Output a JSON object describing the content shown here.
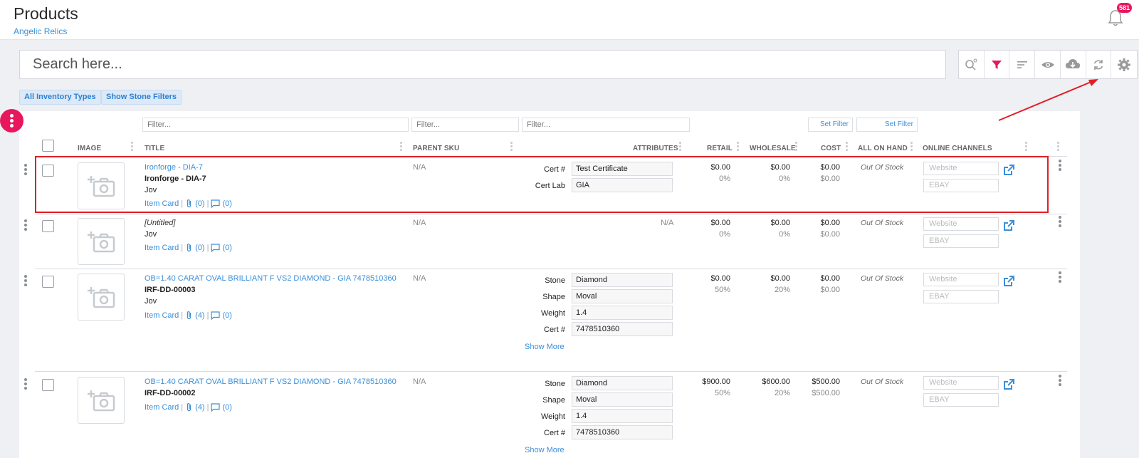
{
  "header": {
    "title": "Products",
    "subtitle": "Angelic Relics",
    "notification_count": "581"
  },
  "search": {
    "placeholder": "Search here..."
  },
  "toolbar": {
    "icons": [
      "search-settings-icon",
      "filter-icon",
      "sort-icon",
      "eye-icon",
      "cloud-download-icon",
      "sync-icon",
      "gear-icon"
    ],
    "filter_color": "#e8175d"
  },
  "filters": {
    "all_inventory": "All Inventory Types",
    "show_stone": "Show Stone Filters",
    "filter_placeholder": "Filter...",
    "set_filter": "Set Filter"
  },
  "columns": {
    "image": "IMAGE",
    "title": "TITLE",
    "parent_sku": "PARENT SKU",
    "attributes": "ATTRIBUTES",
    "retail": "RETAIL",
    "wholesale": "WHOLESALE",
    "cost": "COST",
    "all_on_hand": "ALL ON HAND",
    "online_channels": "ONLINE CHANNELS"
  },
  "common": {
    "item_card": "Item Card",
    "show_more": "Show More",
    "na": "N/A",
    "website": "Website",
    "ebay": "EBAY",
    "out_of_stock": "Out Of Stock"
  },
  "rows": [
    {
      "title": "Ironforge - DIA-7",
      "sku_line": "Ironforge - DIA-7",
      "vendor": "Jov",
      "attachments": "(0)",
      "comments": "(0)",
      "parent_sku": "N/A",
      "attrs": [
        {
          "label": "Cert #",
          "value": "Test Certificate"
        },
        {
          "label": "Cert Lab",
          "value": "GIA"
        }
      ],
      "retail": "$0.00",
      "retail_pct": "0%",
      "wholesale": "$0.00",
      "wholesale_pct": "0%",
      "cost": "$0.00",
      "cost_sub": "$0.00"
    },
    {
      "title": "[Untitled]",
      "vendor": "Jov",
      "attachments": "(0)",
      "comments": "(0)",
      "parent_sku": "N/A",
      "attrs_na": "N/A",
      "retail": "$0.00",
      "retail_pct": "0%",
      "wholesale": "$0.00",
      "wholesale_pct": "0%",
      "cost": "$0.00",
      "cost_sub": "$0.00"
    },
    {
      "title": "OB=1.40 CARAT OVAL BRILLIANT F VS2 DIAMOND - GIA 7478510360",
      "sku_line": "IRF-DD-00003",
      "vendor": "Jov",
      "attachments": "(4)",
      "comments": "(0)",
      "parent_sku": "N/A",
      "attrs": [
        {
          "label": "Stone",
          "value": "Diamond"
        },
        {
          "label": "Shape",
          "value": "Moval"
        },
        {
          "label": "Weight",
          "value": "1.4"
        },
        {
          "label": "Cert #",
          "value": "7478510360"
        }
      ],
      "retail": "$0.00",
      "retail_pct": "50%",
      "wholesale": "$0.00",
      "wholesale_pct": "20%",
      "cost": "$0.00",
      "cost_sub": "$0.00"
    },
    {
      "title": "OB=1.40 CARAT OVAL BRILLIANT F VS2 DIAMOND - GIA 7478510360",
      "sku_line": "IRF-DD-00002",
      "attachments": "(4)",
      "comments": "(0)",
      "parent_sku": "N/A",
      "attrs": [
        {
          "label": "Stone",
          "value": "Diamond"
        },
        {
          "label": "Shape",
          "value": "Moval"
        },
        {
          "label": "Weight",
          "value": "1.4"
        },
        {
          "label": "Cert #",
          "value": "7478510360"
        }
      ],
      "retail": "$900.00",
      "retail_pct": "50%",
      "wholesale": "$600.00",
      "wholesale_pct": "20%",
      "cost": "$500.00",
      "cost_sub": "$500.00"
    }
  ]
}
